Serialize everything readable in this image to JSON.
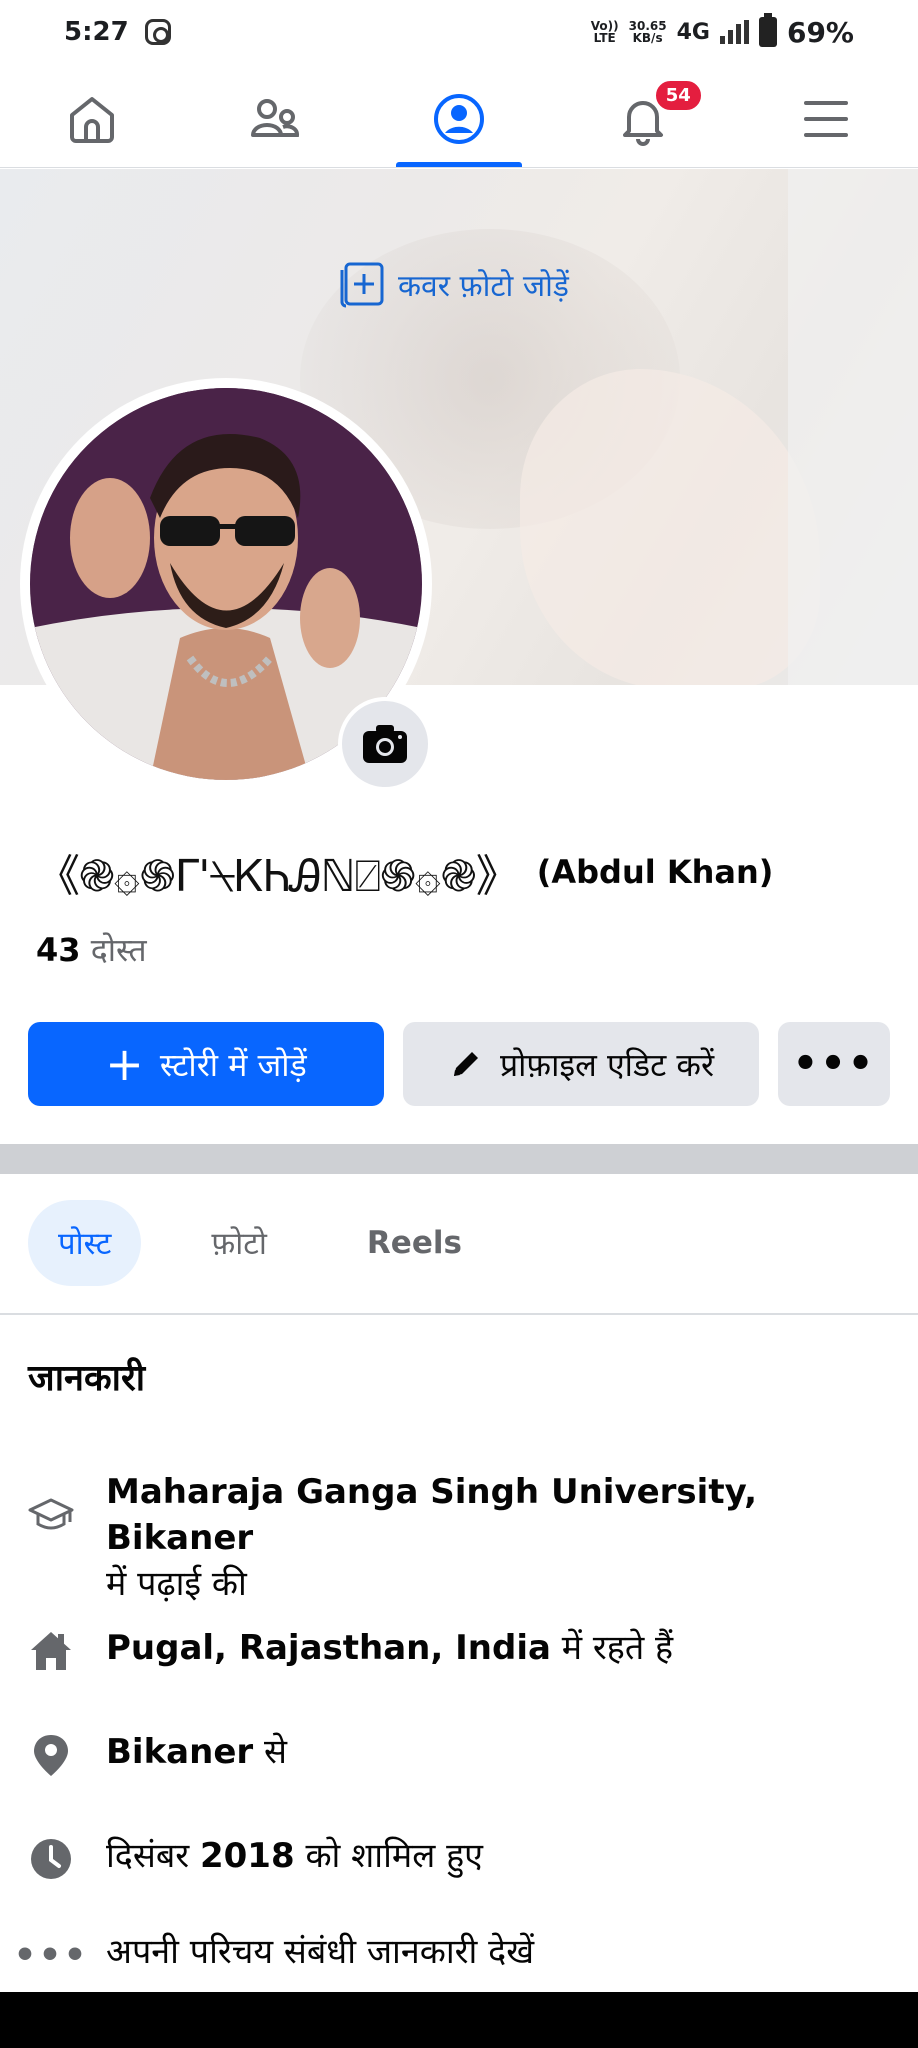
{
  "status_bar": {
    "time": "5:27",
    "volte": "Vo))",
    "lte": "LTE",
    "speed": "30.65",
    "speed_unit": "KB/s",
    "network": "4G",
    "battery": "69%"
  },
  "nav": {
    "notification_count": "54",
    "items": [
      "home-icon",
      "friends-icon",
      "profile-icon",
      "notifications-icon",
      "menu-icon"
    ],
    "active_index": 2,
    "accent_color": "#0866ff"
  },
  "cover": {
    "add_cover_label": "कवर फ़ोटो जोड़ें"
  },
  "profile": {
    "display_name": "《֎۞֍Γ'⍀ᏦᏂᎯℕ⍁֍۞֎》",
    "real_name": "(Abdul Khan)",
    "friends_count": "43",
    "friends_label": "दोस्त"
  },
  "actions": {
    "add_story": "स्टोरी में जोड़ें",
    "edit_profile": "प्रोफ़ाइल एडिट करें",
    "more": "•••"
  },
  "tabs": [
    {
      "label": "पोस्ट",
      "active": true
    },
    {
      "label": "फ़ोटो",
      "active": false
    },
    {
      "label": "Reels",
      "active": false
    }
  ],
  "about": {
    "title": "जानकारी",
    "education_place": "Maharaja Ganga Singh University, Bikaner",
    "education_suffix": "में पढ़ाई की",
    "lives_place": "Pugal, Rajasthan, India",
    "lives_suffix": "में रहते हैं",
    "from_place": "Bikaner",
    "from_suffix": "से",
    "joined_prefix": "दिसंबर",
    "joined_year": "2018",
    "joined_suffix": "को शामिल हुए",
    "see_more": "अपनी परिचय संबंधी जानकारी देखें"
  }
}
